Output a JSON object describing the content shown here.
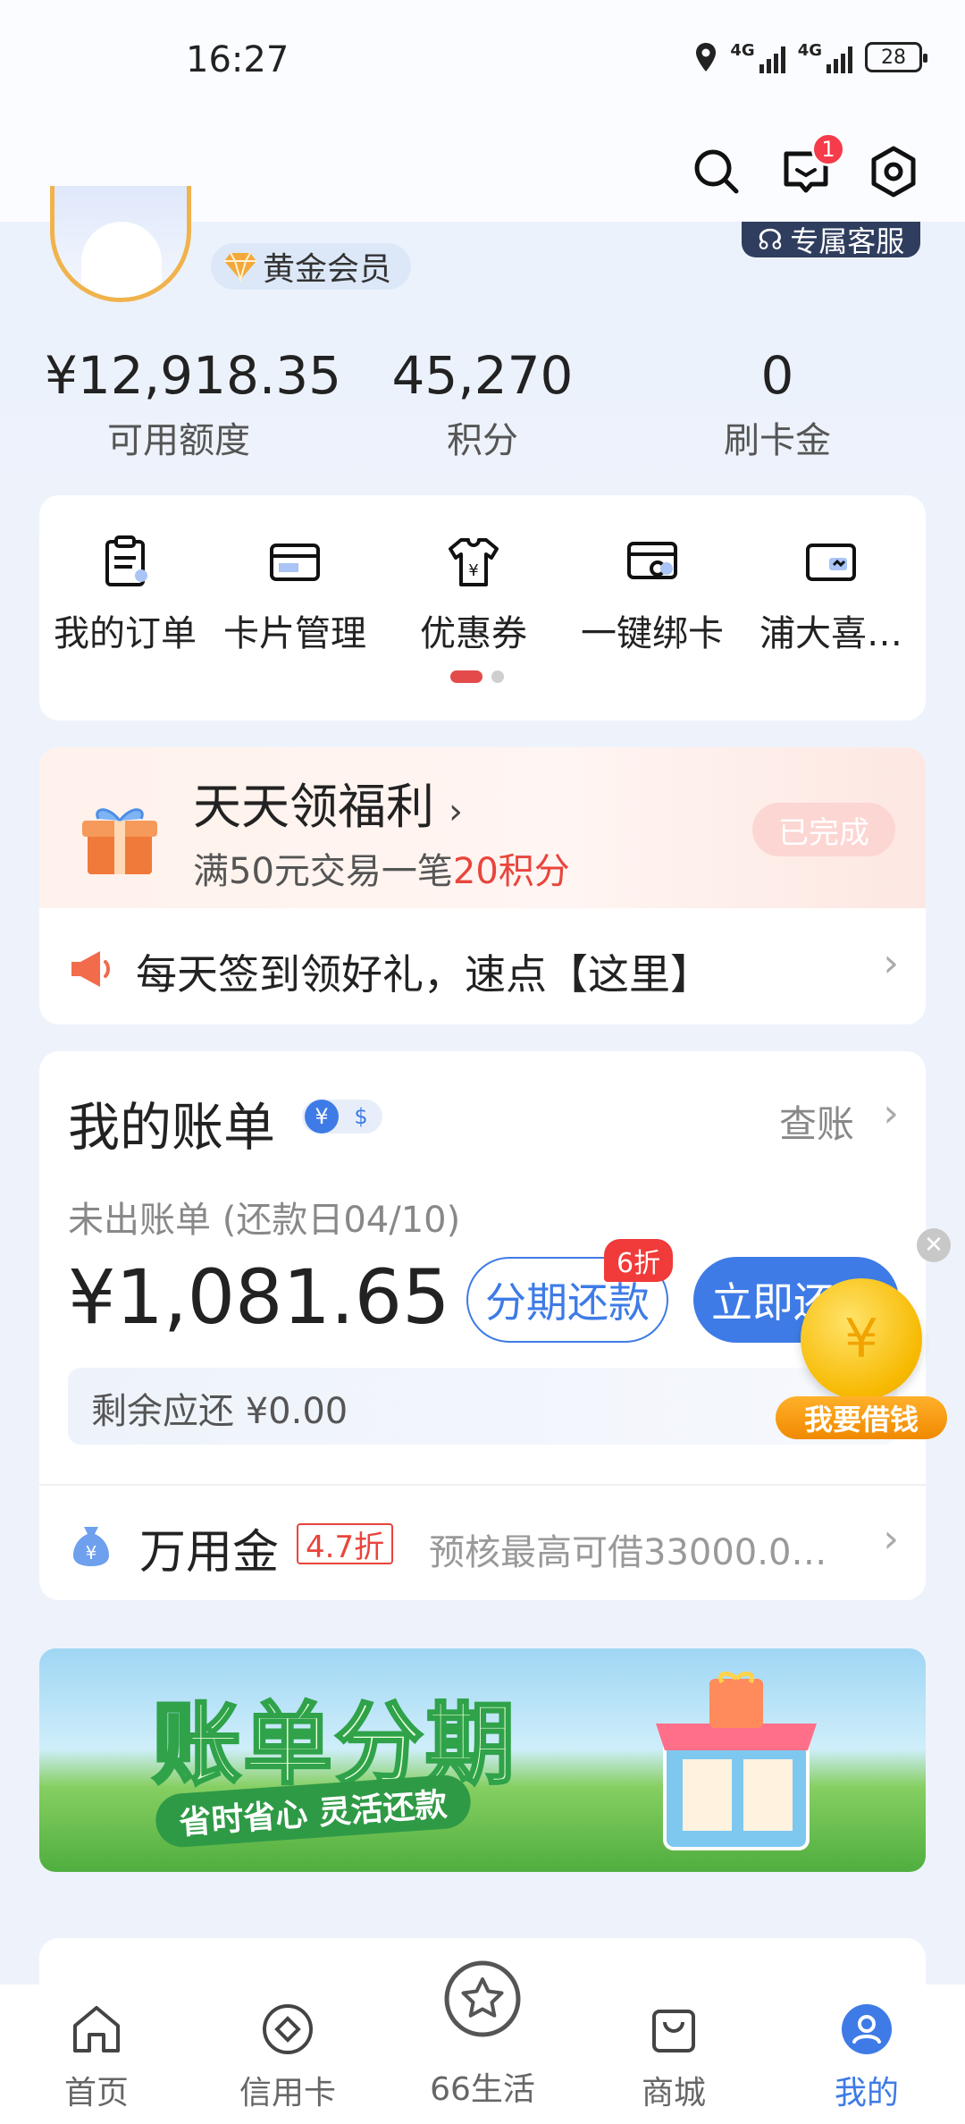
{
  "status_bar": {
    "time": "16:27",
    "network_1": "4G",
    "network_2": "4G",
    "battery": "28"
  },
  "top_bar": {
    "message_badge": "1"
  },
  "profile": {
    "member_level": "黄金会员",
    "service_label": "专属客服"
  },
  "stats": [
    {
      "value": "¥12,918.35",
      "label": "可用额度"
    },
    {
      "value": "45,270",
      "label": "积分"
    },
    {
      "value": "0",
      "label": "刷卡金"
    }
  ],
  "quick_menu": [
    {
      "label": "我的订单",
      "icon": "clipboard-icon"
    },
    {
      "label": "卡片管理",
      "icon": "card-icon"
    },
    {
      "label": "优惠券",
      "icon": "coupon-shirt-icon"
    },
    {
      "label": "一键绑卡",
      "icon": "link-card-icon"
    },
    {
      "label": "浦大喜…",
      "icon": "wallet-card-icon"
    }
  ],
  "welfare": {
    "title": "天天领福利",
    "subtitle_prefix": "满50元交易一笔",
    "subtitle_highlight": "20积分",
    "status": "已完成",
    "notice": "每天签到领好礼，速点【这里】"
  },
  "bill": {
    "title": "我的账单",
    "check_label": "查账",
    "subtitle": "未出账单 (还款日04/10)",
    "amount": "¥1,081.65",
    "installment_label": "分期还款",
    "discount_tag": "6折",
    "pay_label": "立即还款",
    "remaining": "剩余应还 ¥0.00",
    "wan_title": "万用金",
    "wan_tag": "4.7折",
    "wan_desc": "预核最高可借33000.0…"
  },
  "float_loan": {
    "label": "我要借钱",
    "coin_symbol": "¥"
  },
  "banner": {
    "title": "账单分期",
    "subtitle": "省时省心 灵活还款"
  },
  "bottom_nav": [
    {
      "label": "首页",
      "icon": "home-icon"
    },
    {
      "label": "信用卡",
      "icon": "credit-card-icon"
    },
    {
      "label": "66生活",
      "icon": "star-icon"
    },
    {
      "label": "商城",
      "icon": "shopping-bag-icon"
    },
    {
      "label": "我的",
      "icon": "profile-icon"
    }
  ],
  "colors": {
    "accent": "#3e7be6",
    "highlight_red": "#e8453c",
    "gold": "#f0b34c"
  }
}
